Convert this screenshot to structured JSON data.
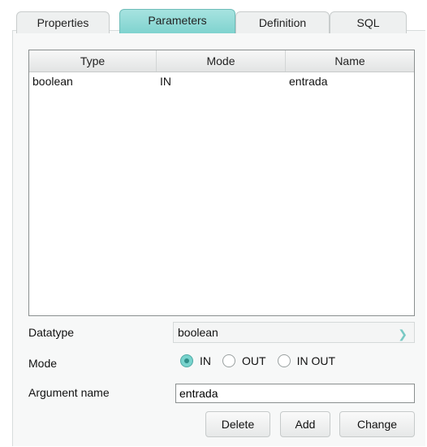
{
  "tabs": [
    {
      "label": "Properties"
    },
    {
      "label": "Parameters",
      "active": true
    },
    {
      "label": "Definition"
    },
    {
      "label": "SQL"
    }
  ],
  "table": {
    "columns": [
      "Type",
      "Mode",
      "Name"
    ],
    "rows": [
      [
        "boolean",
        "IN",
        "entrada"
      ]
    ]
  },
  "form": {
    "datatype_label": "Datatype",
    "datatype_value": "boolean",
    "mode_label": "Mode",
    "mode_options": [
      "IN",
      "OUT",
      "IN OUT"
    ],
    "mode_selected": "IN",
    "argname_label": "Argument name",
    "argname_value": "entrada"
  },
  "buttons": {
    "delete": "Delete",
    "add": "Add",
    "change": "Change"
  },
  "colors": {
    "active_tab": "#7fd3cf",
    "radio_on": "#78d3cd"
  }
}
